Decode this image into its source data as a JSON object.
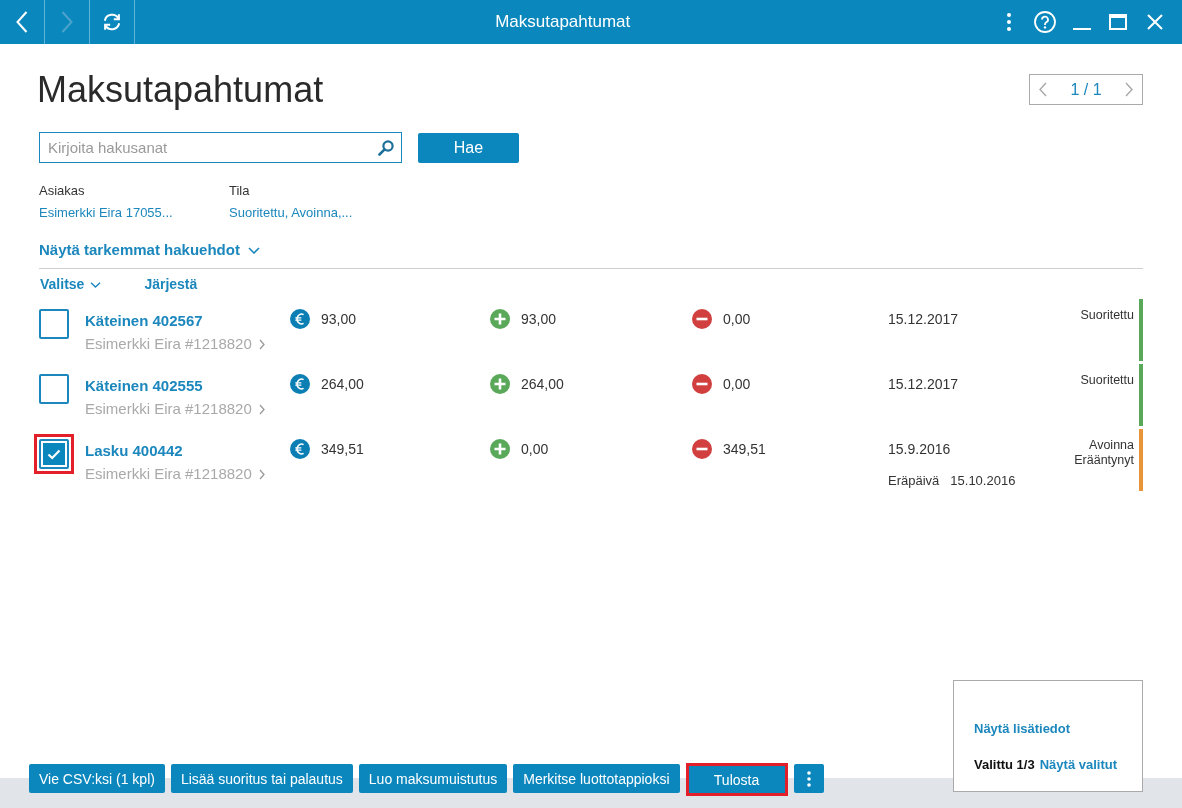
{
  "window": {
    "title": "Maksutapahtumat",
    "nav": [
      {
        "kind": "back",
        "disabled": false
      },
      {
        "kind": "forward",
        "disabled": true
      },
      {
        "kind": "refresh",
        "disabled": false
      }
    ]
  },
  "page": {
    "heading": "Maksutapahtumat",
    "pager": {
      "text": "1 / 1",
      "prev_disabled": true,
      "next_disabled": true
    }
  },
  "search": {
    "placeholder": "Kirjoita hakusanat",
    "button": "Hae"
  },
  "filters": [
    {
      "label": "Asiakas",
      "value": "Esimerkki Eira 17055..."
    },
    {
      "label": "Tila",
      "value": "Suoritettu, Avoinna,..."
    }
  ],
  "advanced_search": {
    "label": "Näytä tarkemmat hakuehdot",
    "expanded": false
  },
  "list_toolbar": {
    "select": "Valitse",
    "sort": "Järjestä"
  },
  "rows": [
    {
      "selected": false,
      "highlighted": false,
      "title": "Käteinen 402567",
      "customer": "Esimerkki Eira #1218820",
      "euro_amount": "93,00",
      "plus_amount": "93,00",
      "minus_amount": "0,00",
      "date": "15.12.2017",
      "status": [
        "Suoritettu"
      ],
      "color": "#5aa85a"
    },
    {
      "selected": false,
      "highlighted": false,
      "title": "Käteinen 402555",
      "customer": "Esimerkki Eira #1218820",
      "euro_amount": "264,00",
      "plus_amount": "264,00",
      "minus_amount": "0,00",
      "date": "15.12.2017",
      "status": [
        "Suoritettu"
      ],
      "color": "#5aa85a"
    },
    {
      "selected": true,
      "highlighted": true,
      "title": "Lasku 400442",
      "customer": "Esimerkki Eira #1218820",
      "euro_amount": "349,51",
      "plus_amount": "0,00",
      "minus_amount": "349,51",
      "date": "15.9.2016",
      "due_label": "Eräpäivä",
      "due_date": "15.10.2016",
      "status": [
        "Avoinna",
        "Erääntynyt"
      ],
      "color": "#e8953a"
    }
  ],
  "actions": [
    {
      "label": "Vie CSV:ksi (1 kpl)",
      "highlighted": false
    },
    {
      "label": "Lisää suoritus tai palautus",
      "highlighted": false
    },
    {
      "label": "Luo maksumuistutus",
      "highlighted": false
    },
    {
      "label": "Merkitse luottotappioksi",
      "highlighted": false
    },
    {
      "label": "Tulosta",
      "highlighted": true
    }
  ],
  "selection_panel": {
    "details_link": "Näytä lisätiedot",
    "selected_count": "Valittu 1/3",
    "show_selected_link": "Näytä valitut"
  }
}
